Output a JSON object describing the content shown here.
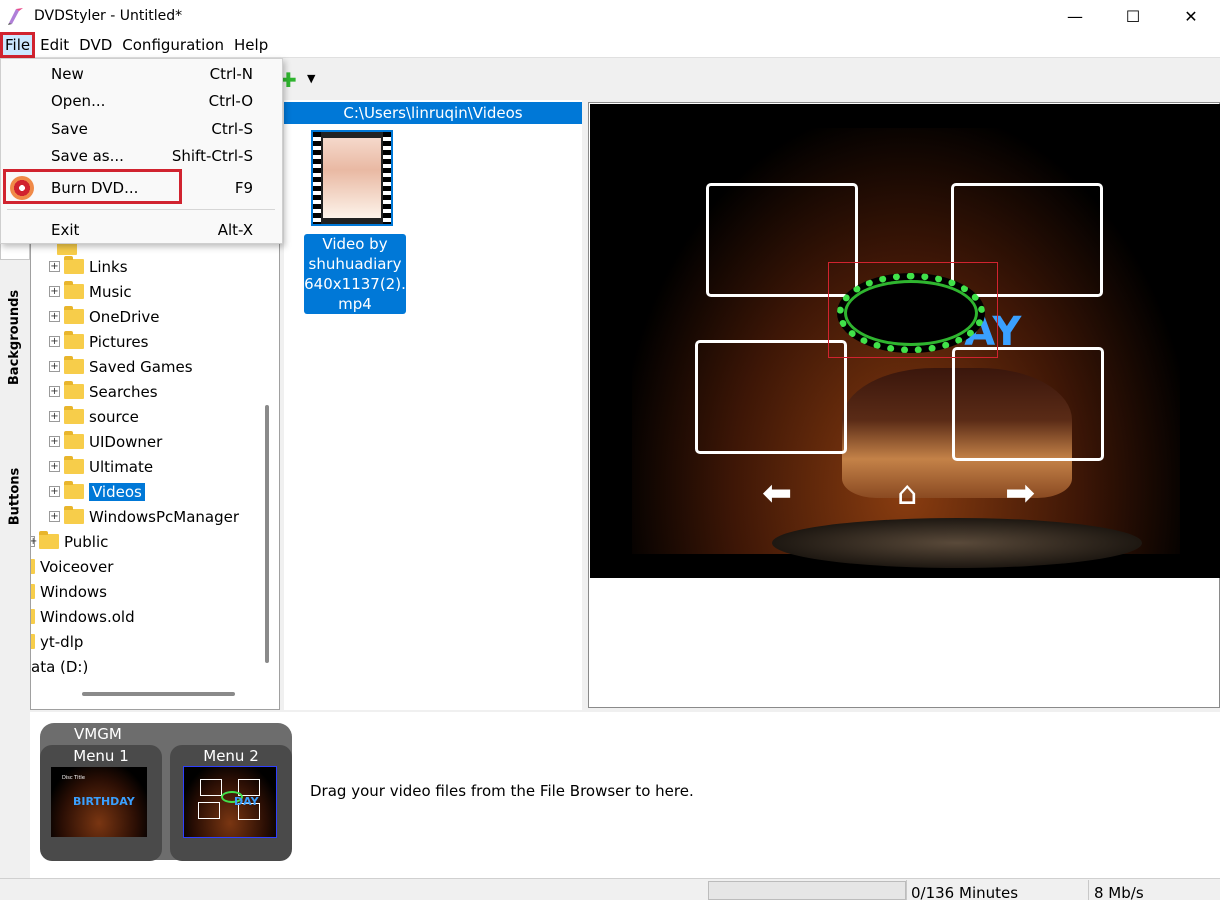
{
  "window": {
    "title": "DVDStyler - Untitled*",
    "controls": {
      "minimize": "—",
      "maximize": "☐",
      "close": "✕"
    }
  },
  "menubar": {
    "items": [
      {
        "label": "File"
      },
      {
        "label": "Edit"
      },
      {
        "label": "DVD"
      },
      {
        "label": "Configuration"
      },
      {
        "label": "Help"
      }
    ]
  },
  "file_menu": {
    "items": [
      {
        "label": "New",
        "shortcut": "Ctrl-N"
      },
      {
        "label": "Open...",
        "shortcut": "Ctrl-O"
      },
      {
        "label": "Save",
        "shortcut": "Ctrl-S"
      },
      {
        "label": "Save as...",
        "shortcut": "Shift-Ctrl-S"
      },
      {
        "label": "Burn DVD...",
        "shortcut": "F9"
      },
      {
        "label": "Exit",
        "shortcut": "Alt-X"
      }
    ]
  },
  "side_tabs": {
    "backgrounds": "Backgrounds",
    "buttons": "Buttons"
  },
  "tree": {
    "nested": [
      "Links",
      "Music",
      "OneDrive",
      "Pictures",
      "Saved Games",
      "Searches",
      "source",
      "UIDowner",
      "Ultimate",
      "Videos",
      "WindowsPcManager"
    ],
    "selected": "Videos",
    "public": "Public",
    "top_level": [
      "Voiceover",
      "Windows",
      "Windows.old",
      "yt-dlp"
    ],
    "drive": "ata (D:)"
  },
  "file_browser": {
    "path": "C:\\Users\\linruqin\\Videos",
    "file_label_line1": "Video by",
    "file_label_line2": "shuhuadiary",
    "file_label_line3": "640x1137(2).",
    "file_label_line4": "mp4"
  },
  "preview": {
    "cake_text": "DAY",
    "nav_left": "⬅",
    "nav_home": "⌂",
    "nav_right": "➡"
  },
  "titleset": {
    "vmgm_label": "VMGM",
    "menus": [
      {
        "label": "Menu 1",
        "mini_title": "Disc Title",
        "mini_text": "BIRTHDAY"
      },
      {
        "label": "Menu 2",
        "mini_text": "DAY"
      }
    ],
    "drag_hint": "Drag your video files from the File Browser to here."
  },
  "status": {
    "minutes": "0/136 Minutes",
    "bitrate": "8 Mb/s"
  },
  "colors": {
    "accent": "#0078d7",
    "highlight_red": "#d1232f",
    "button_green": "#41e24a"
  }
}
